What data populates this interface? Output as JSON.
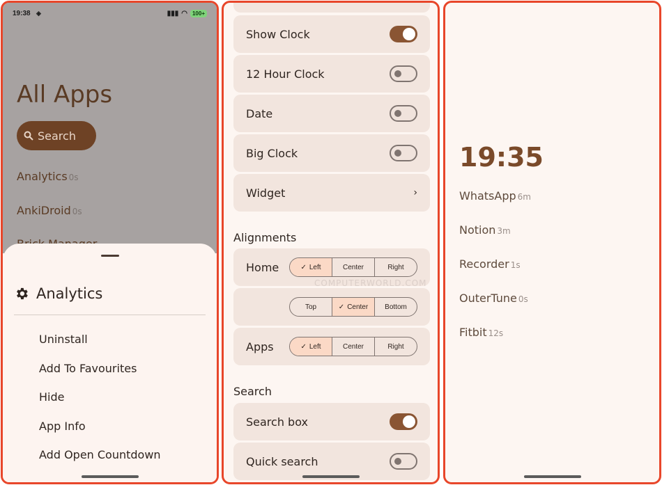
{
  "panel1": {
    "status": {
      "time": "19:38",
      "battery": "100+"
    },
    "title": "All Apps",
    "search_label": "Search",
    "apps": [
      {
        "name": "Analytics",
        "dur": "0s"
      },
      {
        "name": "AnkiDroid",
        "dur": "0s"
      },
      {
        "name": "Brick Manager",
        "dur": ""
      }
    ],
    "sheet": {
      "title": "Analytics",
      "items": [
        "Uninstall",
        "Add To Favourites",
        "Hide",
        "App Info",
        "Add Open Countdown"
      ]
    }
  },
  "panel2": {
    "toggles": [
      {
        "label": "Show Clock",
        "on": true
      },
      {
        "label": "12 Hour Clock",
        "on": false
      },
      {
        "label": "Date",
        "on": false
      },
      {
        "label": "Big Clock",
        "on": false
      }
    ],
    "widget_label": "Widget",
    "alignments_header": "Alignments",
    "home_label": "Home",
    "home_options": [
      "Left",
      "Center",
      "Right"
    ],
    "home_selected": "Left",
    "vertical_options": [
      "Top",
      "Center",
      "Bottom"
    ],
    "vertical_selected": "Center",
    "apps_label": "Apps",
    "apps_options": [
      "Left",
      "Center",
      "Right"
    ],
    "apps_selected": "Left",
    "search_header": "Search",
    "search_toggles": [
      {
        "label": "Search box",
        "on": true
      },
      {
        "label": "Quick search",
        "on": false
      }
    ],
    "watermark": "COMPUTERWORLD.COM"
  },
  "panel3": {
    "time": "19:35",
    "apps": [
      {
        "name": "WhatsApp",
        "dur": "6m"
      },
      {
        "name": "Notion",
        "dur": "3m"
      },
      {
        "name": "Recorder",
        "dur": "1s"
      },
      {
        "name": "OuterTune",
        "dur": "0s"
      },
      {
        "name": "Fitbit",
        "dur": "12s"
      }
    ]
  }
}
